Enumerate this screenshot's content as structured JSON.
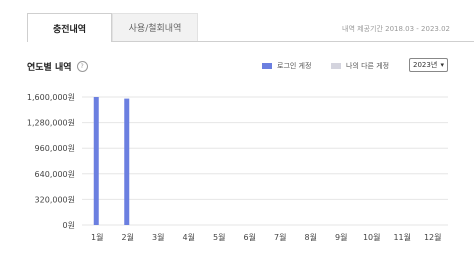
{
  "tabs": [
    {
      "label": "충전내역",
      "active": true
    },
    {
      "label": "사용/철회내역",
      "active": false
    }
  ],
  "period_text": "내역 제공기간 2018.03 - 2023.02",
  "section_title": "연도별 내역",
  "help_icon_glyph": "?",
  "legend": [
    {
      "label": "로그인 게정",
      "color": "#6b7fe0"
    },
    {
      "label": "나의 다른 게정",
      "color": "#d4d4de"
    }
  ],
  "year_select": {
    "value": "2023년",
    "arrow": "▾"
  },
  "chart_data": {
    "type": "bar",
    "categories": [
      "1월",
      "2월",
      "3월",
      "4월",
      "5월",
      "6월",
      "7월",
      "8월",
      "9월",
      "10월",
      "11월",
      "12월"
    ],
    "series": [
      {
        "name": "로그인 게정",
        "values": [
          1600000,
          1580000,
          0,
          0,
          0,
          0,
          0,
          0,
          0,
          0,
          0,
          0
        ]
      },
      {
        "name": "나의 다른 게정",
        "values": [
          0,
          0,
          0,
          0,
          0,
          0,
          0,
          0,
          0,
          0,
          0,
          0
        ]
      }
    ],
    "yticks": [
      "0원",
      "320,000원",
      "640,000원",
      "960,000원",
      "1,280,000원",
      "1,600,000원"
    ],
    "ylim": [
      0,
      1600000
    ],
    "grid": true,
    "legend_position": "top-right"
  }
}
